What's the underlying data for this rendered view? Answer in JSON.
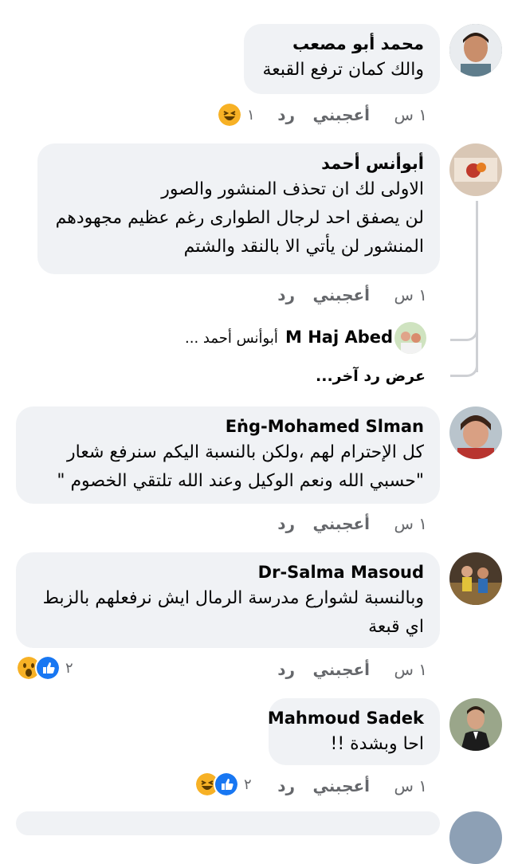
{
  "comments": [
    {
      "author": "محمد أبو مصعب",
      "lines": [
        "والك كمان ترفع القبعة"
      ],
      "time": "١ س",
      "like": "أعجبني",
      "reply": "رد",
      "reaction_count": "١"
    },
    {
      "author": "أبوأنس أحمد",
      "lines": [
        "الاولى لك ان تحذف المنشور والصور",
        "لن يصفق احد لرجال الطوارى رغم عظيم مجهودهم",
        "المنشور لن يأتي الا بالنقد والشتم"
      ],
      "time": "١ س",
      "like": "أعجبني",
      "reply": "رد"
    },
    {
      "author": "Eṅg-Mohamed Slman",
      "lines": [
        "كل الإحترام لهم ،ولكن بالنسبة اليكم سنرفع شعار",
        "\"حسبي الله ونعم الوكيل وعند الله تلتقي الخصوم \""
      ],
      "time": "١ س",
      "like": "أعجبني",
      "reply": "رد"
    },
    {
      "author": "Dr-Salma Masoud",
      "lines": [
        "وبالنسبة لشوارع مدرسة الرمال ايش نرفعلهم بالزبط",
        "اي قبعة"
      ],
      "time": "١ س",
      "like": "أعجبني",
      "reply": "رد",
      "reaction_count": "٢"
    },
    {
      "author": "Mahmoud Sadek",
      "lines": [
        "احا وبشدة !!"
      ],
      "time": "١ س",
      "like": "أعجبني",
      "reply": "رد",
      "reaction_count": "٢"
    }
  ],
  "reply_preview": {
    "author": "M Haj Abed",
    "snippet": "أبوأنس أحمد ..."
  },
  "view_more": "عرض رد آخر...",
  "colors": {
    "bubble": "#f0f2f5",
    "meta": "#65676b",
    "like_blue": "#1877f2",
    "haha_yellow": "#f7b125"
  }
}
